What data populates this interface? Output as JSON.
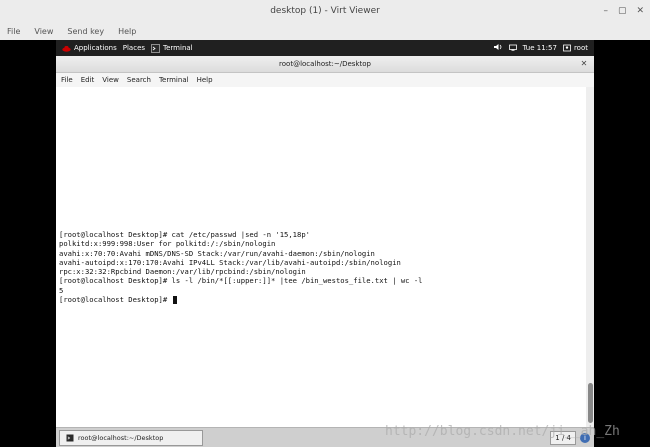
{
  "outer_window": {
    "title": "desktop (1) - Virt Viewer",
    "menu": [
      "File",
      "View",
      "Send key",
      "Help"
    ],
    "controls": [
      "–",
      "▢",
      "✕"
    ]
  },
  "gnome_bar": {
    "applications": "Applications",
    "places": "Places",
    "terminal": "Terminal",
    "time": "Tue 11:57",
    "user": "root"
  },
  "terminal_window": {
    "title": "root@localhost:~/Desktop",
    "menu": [
      "File",
      "Edit",
      "View",
      "Search",
      "Terminal",
      "Help"
    ],
    "lines": [
      "[root@localhost Desktop]# cat /etc/passwd |sed -n '15,18p'",
      "polkitd:x:999:998:User for polkitd:/:/sbin/nologin",
      "avahi:x:70:70:Avahi mDNS/DNS-SD Stack:/var/run/avahi-daemon:/sbin/nologin",
      "avahi-autoipd:x:170:170:Avahi IPv4LL Stack:/var/lib/avahi-autoipd:/sbin/nologin",
      "rpc:x:32:32:Rpcbind Daemon:/var/lib/rpcbind:/sbin/nologin",
      "[root@localhost Desktop]# ls -l /bin/*[[:upper:]]* |tee /bin_westos_file.txt | wc -l",
      "5",
      "[root@localhost Desktop]# "
    ]
  },
  "taskbar": {
    "item_label": "root@localhost:~/Desktop",
    "pager": "1 / 4"
  },
  "watermark": "http://blog.csdn.net/ji__ah_Zh"
}
